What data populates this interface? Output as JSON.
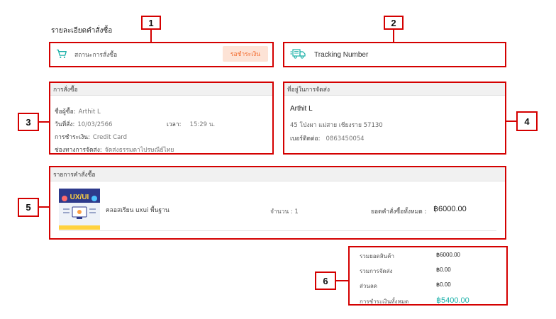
{
  "page": {
    "heading": "รายละเอียดคำสั่งซื้อ"
  },
  "colors": {
    "callout": "#d40000",
    "status_bg": "#fde3d6",
    "status_text": "#f26c2f",
    "accent_total": "#1ab0a8"
  },
  "callouts": [
    "1",
    "2",
    "3",
    "4",
    "5",
    "6"
  ],
  "status": {
    "label": "สถานะการสั่งซื้อ",
    "badge": "รอชำระเงิน",
    "icon": "cart-icon"
  },
  "tracking": {
    "label": "Tracking Number",
    "icon": "truck-icon"
  },
  "order": {
    "title": "การสั่งซื้อ",
    "buyer_label": "ชื่อผู้ซื้อ:",
    "buyer": "Arthit L",
    "date_label": "วันที่สั่ง:",
    "date": "10/03/2566",
    "time_label": "เวลา:",
    "time": "15:29 น.",
    "payment_label": "การชำระเงิน:",
    "payment": "Credit Card",
    "shipping_label": "ช่องทางการจัดส่ง:",
    "shipping": "จัดส่งธรรมดาไปรษณีย์ไทย"
  },
  "address": {
    "title": "ที่อยู่ในการจัดส่ง",
    "name": "Arthit L",
    "line": "45 โป่งผา แม่สาย เชียงราย 57130",
    "phone_label": "เบอร์ติดต่อ:",
    "phone": "0863450054"
  },
  "items": {
    "title": "รายการคำสั่งซื้อ",
    "rows": [
      {
        "name": "คลอสเรียน uxui พื้นฐาน",
        "qty": "จำนวน : 1",
        "total_label": "ยอดคำสั่งซื้อทั้งหมด :",
        "total": "฿6000.00",
        "thumb_text": "UX/UI"
      }
    ]
  },
  "summary": {
    "rows": [
      {
        "label": "รวมยอดสินค้า",
        "value": "฿6000.00"
      },
      {
        "label": "รวมการจัดส่ง",
        "value": "฿0.00"
      },
      {
        "label": "ส่วนลด",
        "value": "฿0.00"
      },
      {
        "label": "การชำระเงินทั้งหมด",
        "value": "฿5400.00"
      }
    ]
  }
}
